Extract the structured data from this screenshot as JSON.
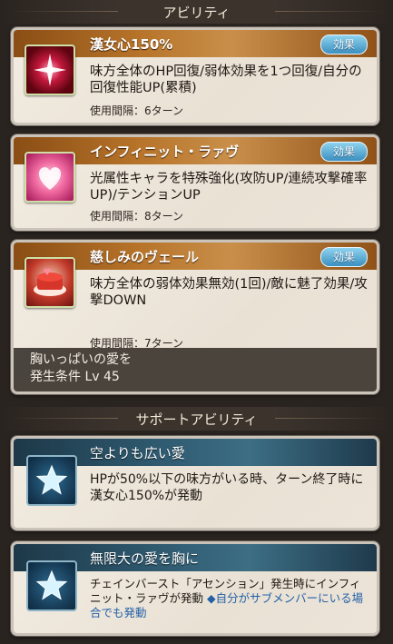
{
  "sections": {
    "abilities_title": "アビリティ",
    "support_title": "サポートアビリティ"
  },
  "abilities": [
    {
      "name": "漢女心150%",
      "badge": "効果",
      "description": "味方全体のHP回復/弱体効果を1つ回復/自分の回復性能UP(累積)",
      "cooldown": "使用間隔：6ターン"
    },
    {
      "name": "インフィニット・ラァヴ",
      "badge": "効果",
      "description": "光属性キャラを特殊強化(攻防UP/連続攻撃確率UP)/テンションUP",
      "cooldown": "使用間隔：8ターン"
    },
    {
      "name": "慈しみのヴェール",
      "badge": "効果",
      "description": "味方全体の弱体効果無効(1回)/敵に魅了効果/攻撃DOWN",
      "cooldown": "使用間隔：7ターン",
      "unlock_name": "胸いっぱいの愛を",
      "unlock_condition": "発生条件 Lv 45"
    }
  ],
  "support_abilities": [
    {
      "name": "空よりも広い愛",
      "description": "HPが50%以下の味方がいる時、ターン終了時に漢女心150%が発動"
    },
    {
      "name": "無限大の愛を胸に",
      "description": "チェインバースト「アセンション」発生時にインフィニット・ラァヴが発動",
      "note": "◆自分がサブメンバーにいる場合でも発動"
    }
  ],
  "colors": {
    "ability_bar": "#b7742a",
    "support_bar": "#2f5a70",
    "badge": "#3b8fc0",
    "note_text": "#2360a8"
  },
  "icons": [
    "sparkle-star-icon",
    "heart-icon",
    "cake-icon",
    "blue-star-icon"
  ]
}
